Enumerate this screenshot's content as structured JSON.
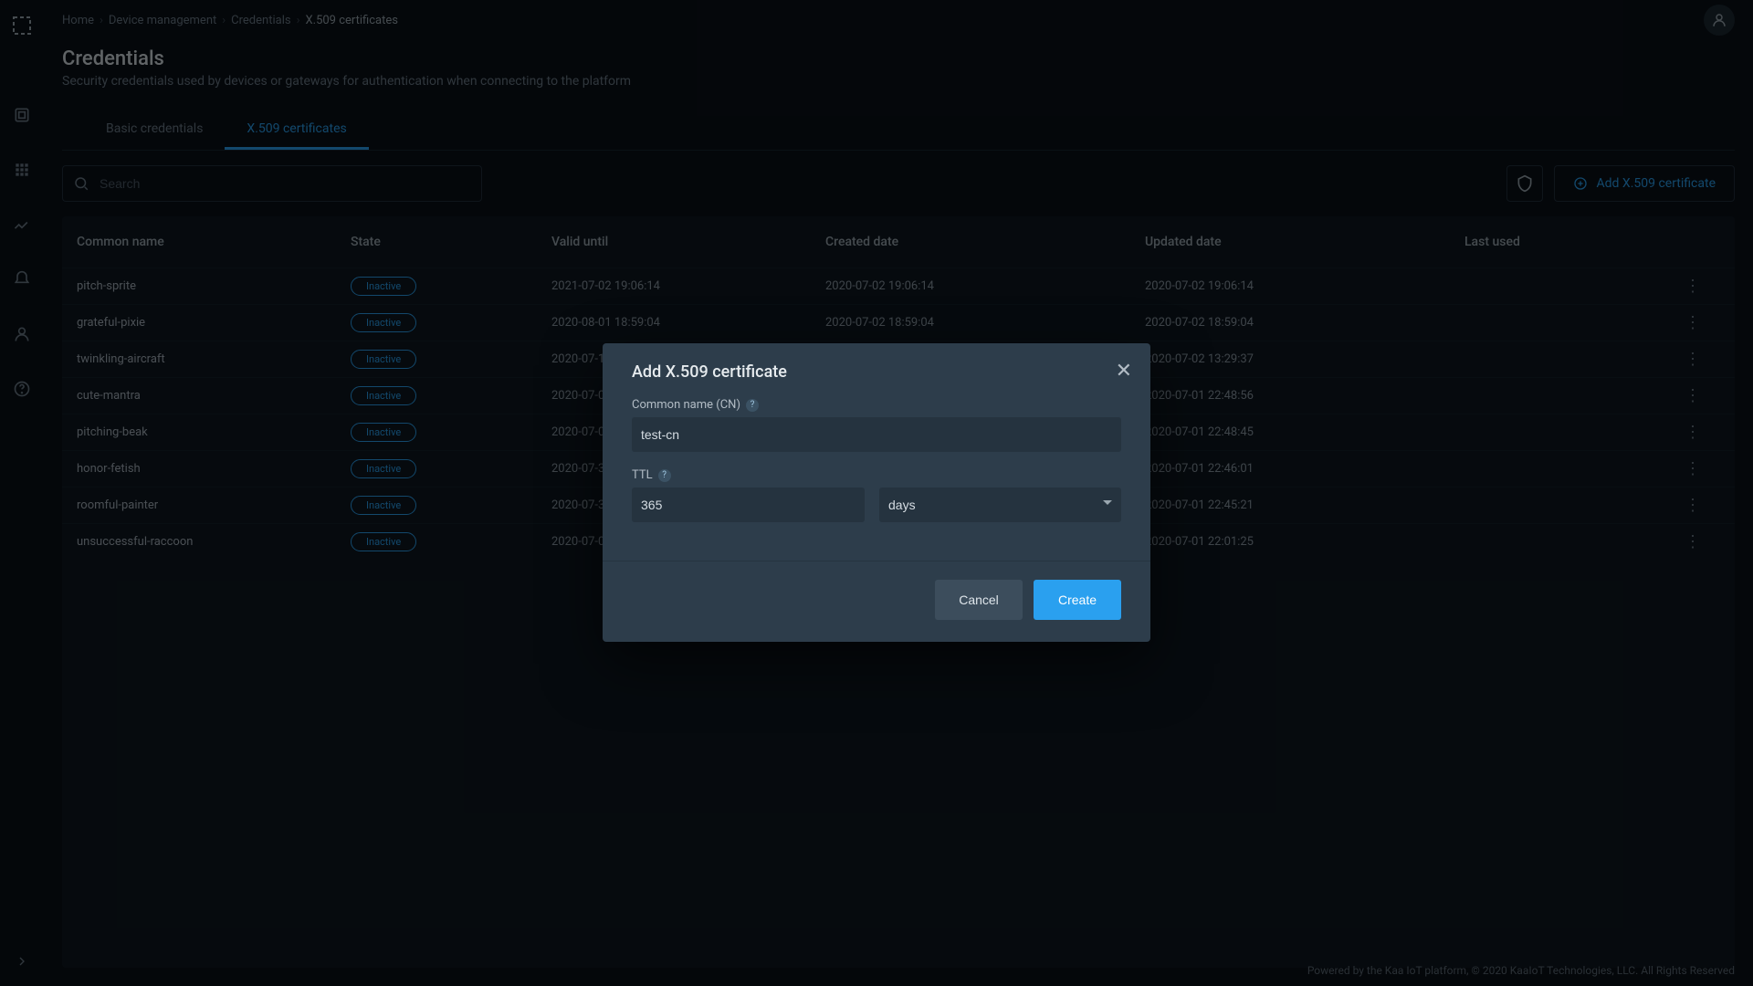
{
  "breadcrumb": [
    "Home",
    "Device management",
    "Credentials",
    "X.509 certificates"
  ],
  "page": {
    "title": "Credentials",
    "subtitle": "Security credentials used by devices or gateways for authentication when connecting to the platform"
  },
  "tabs": [
    {
      "label": "Basic credentials",
      "active": false
    },
    {
      "label": "X.509 certificates",
      "active": true
    }
  ],
  "search": {
    "placeholder": "Search"
  },
  "addButton": {
    "label": "Add X.509 certificate"
  },
  "columns": [
    "Common name",
    "State",
    "Valid until",
    "Created date",
    "Updated date",
    "Last used",
    ""
  ],
  "stateLabel": "Inactive",
  "rows": [
    {
      "name": "pitch-sprite",
      "valid": "2021-07-02 19:06:14",
      "created": "2020-07-02 19:06:14",
      "updated": "2020-07-02 19:06:14"
    },
    {
      "name": "grateful-pixie",
      "valid": "2020-08-01 18:59:04",
      "created": "2020-07-02 18:59:04",
      "updated": "2020-07-02 18:59:04"
    },
    {
      "name": "twinkling-aircraft",
      "valid": "2020-07-1",
      "created": "",
      "updated": "2020-07-02 13:29:37"
    },
    {
      "name": "cute-mantra",
      "valid": "2020-07-0",
      "created": "",
      "updated": "2020-07-01 22:48:56"
    },
    {
      "name": "pitching-beak",
      "valid": "2020-07-0",
      "created": "",
      "updated": "2020-07-01 22:48:45"
    },
    {
      "name": "honor-fetish",
      "valid": "2020-07-3",
      "created": "",
      "updated": "2020-07-01 22:46:01"
    },
    {
      "name": "roomful-painter",
      "valid": "2020-07-3",
      "created": "",
      "updated": "2020-07-01 22:45:21"
    },
    {
      "name": "unsuccessful-raccoon",
      "valid": "2020-07-0",
      "created": "",
      "updated": "2020-07-01 22:01:25"
    }
  ],
  "modal": {
    "title": "Add X.509 certificate",
    "cnLabel": "Common name (CN)",
    "cnValue": "test-cn",
    "ttlLabel": "TTL",
    "ttlValue": "365",
    "ttlUnit": "days",
    "cancel": "Cancel",
    "create": "Create"
  },
  "footer": "Powered by the Kaa IoT platform, © 2020 KaaIoT Technologies, LLC. All Rights Reserved"
}
